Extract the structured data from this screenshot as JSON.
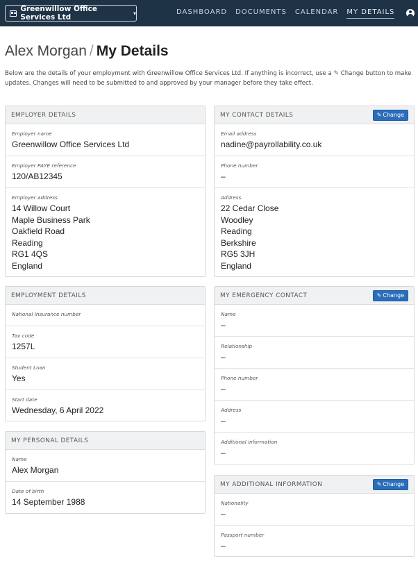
{
  "nav": {
    "company": "Greenwillow Office Services Ltd",
    "links": [
      "DASHBOARD",
      "DOCUMENTS",
      "CALENDAR",
      "MY DETAILS"
    ]
  },
  "title": {
    "name": "Alex Morgan",
    "separator": "/",
    "section": "My Details"
  },
  "intro": {
    "before": "Below are the details of your employment with Greenwillow Office Services Ltd. If anything is incorrect, use a",
    "change_word": "Change",
    "after": "button to make updates. Changes will need to be submitted to and approved by your manager before they take effect."
  },
  "change_label": "Change",
  "employer": {
    "title": "EMPLOYER DETAILS",
    "name_label": "Employer name",
    "name": "Greenwillow Office Services Ltd",
    "paye_label": "Employer PAYE reference",
    "paye": "120/AB12345",
    "address_label": "Employer address",
    "address": [
      "14 Willow Court",
      "Maple Business Park",
      "Oakfield Road",
      "Reading",
      "RG1 4QS",
      "England"
    ]
  },
  "contact": {
    "title": "MY CONTACT DETAILS",
    "email_label": "Email address",
    "email": "nadine@payrollability.co.uk",
    "phone_label": "Phone number",
    "phone": "–",
    "address_label": "Address",
    "address": [
      "22 Cedar Close",
      "Woodley",
      "Reading",
      "Berkshire",
      "RG5 3JH",
      "England"
    ]
  },
  "employment": {
    "title": "EMPLOYMENT DETAILS",
    "ni_label": "National Insurance number",
    "ni": "",
    "tax_label": "Tax code",
    "tax": "1257L",
    "loan_label": "Student Loan",
    "loan": "Yes",
    "start_label": "Start date",
    "start": "Wednesday, 6 April 2022"
  },
  "emergency": {
    "title": "MY EMERGENCY CONTACT",
    "name_label": "Name",
    "name": "–",
    "relationship_label": "Relationship",
    "relationship": "–",
    "phone_label": "Phone number",
    "phone": "–",
    "address_label": "Address",
    "address": "–",
    "info_label": "Additional information",
    "info": "–"
  },
  "personal": {
    "title": "MY PERSONAL DETAILS",
    "name_label": "Name",
    "name": "Alex Morgan",
    "dob_label": "Date of birth",
    "dob": "14 September 1988"
  },
  "additional": {
    "title": "MY ADDITIONAL INFORMATION",
    "nationality_label": "Nationality",
    "nationality": "–",
    "passport_label": "Passport number",
    "passport": "–"
  },
  "colors": {
    "nav_bg": "#1f3347",
    "button_blue": "#2a6ebb",
    "header_bg": "#f0f1f2"
  },
  "icons": {
    "company": "id-card-icon",
    "user": "user-circle-icon",
    "change": "pencil-icon"
  }
}
